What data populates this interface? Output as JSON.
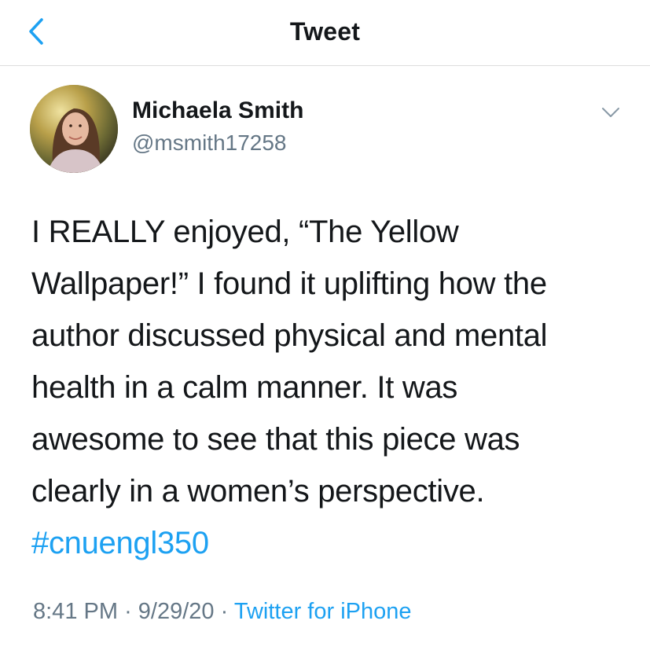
{
  "header": {
    "title": "Tweet"
  },
  "icons": {
    "back": "chevron-left-icon",
    "more": "chevron-down-icon"
  },
  "colors": {
    "accent": "#1da1f2",
    "secondary_text": "#657786",
    "primary_text": "#14171a"
  },
  "author": {
    "name": "Michaela Smith",
    "handle": "@msmith17258"
  },
  "tweet": {
    "lines": [
      "I REALLY enjoyed, “The Yellow",
      "Wallpaper!” I found it uplifting how the",
      "author discussed physical and mental",
      "health in a calm manner. It was",
      "awesome to see that this piece was",
      "clearly in a women’s perspective."
    ],
    "hashtag": "#cnuengl350"
  },
  "meta": {
    "time": "8:41 PM",
    "separator": "·",
    "date": "9/29/20",
    "source": "Twitter for iPhone"
  }
}
